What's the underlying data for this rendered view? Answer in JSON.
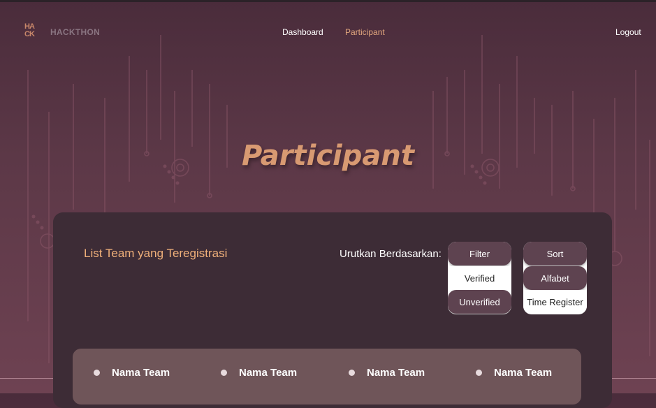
{
  "nav": {
    "logo_text": "HA CK",
    "brand": "HACKTHON",
    "links": [
      {
        "label": "Dashboard",
        "active": false
      },
      {
        "label": "Participant",
        "active": true
      }
    ],
    "logout": "Logout"
  },
  "hero": {
    "title": "Participant"
  },
  "panel": {
    "title": "List Team yang Teregistrasi",
    "sort_label": "Urutkan Berdasarkan:",
    "filter": {
      "label": "Filter",
      "options": [
        "Verified",
        "Unverified"
      ]
    },
    "sort": {
      "label": "Sort",
      "options": [
        "Alfabet",
        "Time Register"
      ]
    }
  },
  "teams": [
    "Nama Team",
    "Nama Team",
    "Nama Team",
    "Nama Team"
  ],
  "colors": {
    "accent": "#e2a77e",
    "panel": "#3d2c36",
    "list": "#6f5559",
    "button": "#5e4350"
  }
}
